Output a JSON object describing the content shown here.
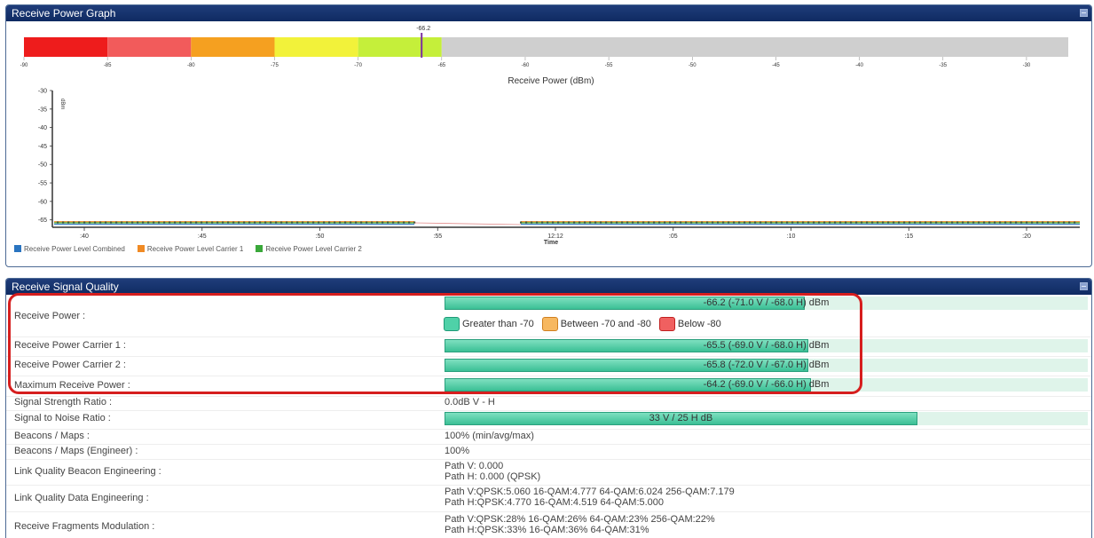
{
  "graph_panel": {
    "title": "Receive Power Graph"
  },
  "power_bar": {
    "current_value": "-66.2",
    "axis_label": "Receive Power (dBm)",
    "ticks": [
      "-90",
      "-85",
      "-80",
      "-75",
      "-70",
      "-65",
      "-60",
      "-55",
      "-50",
      "-45",
      "-40",
      "-35",
      "-30"
    ],
    "colors": [
      "#ee1c1c",
      "#f25b5b",
      "#f5a020",
      "#f2f23a",
      "#c5ef3a",
      "#cfcfcf"
    ]
  },
  "chart_data": {
    "type": "line",
    "ylabel": "dBm",
    "xlabel": "Time",
    "ylim": [
      -67,
      -30
    ],
    "yticks": [
      "-30",
      "-35",
      "-40",
      "-45",
      "-50",
      "-55",
      "-60",
      "-65"
    ],
    "xticks": [
      ":40",
      ":45",
      ":50",
      ":55",
      "12:12",
      ":05",
      ":10",
      ":15",
      ":20"
    ],
    "series": [
      {
        "name": "Receive Power Level Combined",
        "color": "#2a74c0",
        "value": -66.2
      },
      {
        "name": "Receive Power Level Carrier 1",
        "color": "#f08a24",
        "value": -65.5
      },
      {
        "name": "Receive Power Level Carrier 2",
        "color": "#3aa83a",
        "value": -65.8
      }
    ]
  },
  "quality_panel": {
    "title": "Receive Signal Quality"
  },
  "rows": {
    "receive_power": {
      "label": "Receive Power :",
      "text": "-66.2 (-71.0 V / -68.0 H) dBm",
      "fraction": 0.56
    },
    "legend": {
      "green": "Greater than -70",
      "orange": "Between -70 and -80",
      "red": "Below -80",
      "green_color": "#4fd1a8",
      "orange_color": "#f7b860",
      "red_color": "#f06060"
    },
    "carrier1": {
      "label": "Receive Power Carrier 1 :",
      "text": "-65.5 (-69.0 V / -68.0 H) dBm",
      "fraction": 0.565
    },
    "carrier2": {
      "label": "Receive Power Carrier 2 :",
      "text": "-65.8 (-72.0 V / -67.0 H) dBm",
      "fraction": 0.565
    },
    "max_power": {
      "label": "Maximum Receive Power :",
      "text": "-64.2 (-69.0 V / -66.0 H) dBm",
      "fraction": 0.57
    },
    "ssr": {
      "label": "Signal Strength Ratio :",
      "value": "0.0dB V - H"
    },
    "snr": {
      "label": "Signal to Noise Ratio :",
      "text": "33 V / 25 H dB",
      "fraction": 0.735
    },
    "beacons": {
      "label": "Beacons / Maps :",
      "value": "100% (min/avg/max)"
    },
    "beacons_eng": {
      "label": "Beacons / Maps (Engineer) :",
      "value": "100%"
    },
    "lqbe": {
      "label": "Link Quality Beacon Engineering :",
      "line1": "Path V: 0.000",
      "line2": "Path H: 0.000 (QPSK)"
    },
    "lqde": {
      "label": "Link Quality Data Engineering :",
      "line1": "Path V:QPSK:5.060 16-QAM:4.777 64-QAM:6.024 256-QAM:7.179",
      "line2": "Path H:QPSK:4.770 16-QAM:4.519 64-QAM:5.000"
    },
    "rfm": {
      "label": "Receive Fragments Modulation :",
      "line1": "Path V:QPSK:28% 16-QAM:26% 64-QAM:23% 256-QAM:22%",
      "line2": "Path H:QPSK:33% 16-QAM:36% 64-QAM:31%"
    }
  }
}
